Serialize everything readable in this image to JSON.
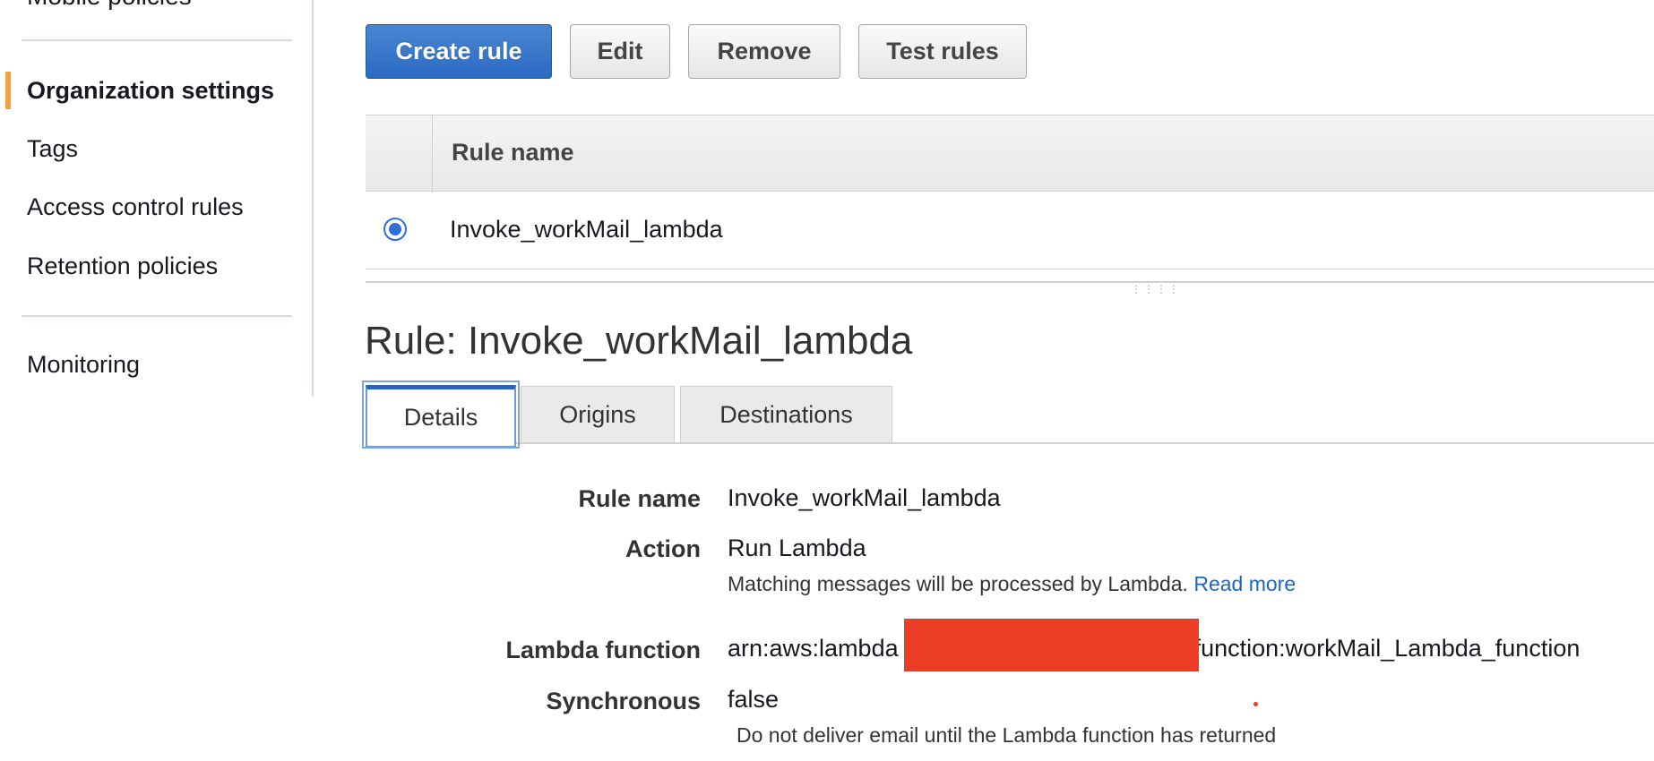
{
  "sidebar": {
    "cut_off_item": "Mobile policies",
    "items": [
      {
        "label": "Organization settings",
        "active": true
      },
      {
        "label": "Tags",
        "active": false
      },
      {
        "label": "Access control rules",
        "active": false
      },
      {
        "label": "Retention policies",
        "active": false
      },
      {
        "label": "Monitoring",
        "active": false
      }
    ],
    "accent_color": "#f5a13d"
  },
  "toolbar": {
    "create_rule": "Create rule",
    "edit": "Edit",
    "remove": "Remove",
    "test_rules": "Test rules"
  },
  "rules_table": {
    "column_header": "Rule name",
    "rows": [
      {
        "name": "Invoke_workMail_lambda",
        "selected": true
      }
    ]
  },
  "rule_detail": {
    "title": "Rule: Invoke_workMail_lambda",
    "tabs": [
      {
        "label": "Details",
        "active": true
      },
      {
        "label": "Origins",
        "active": false
      },
      {
        "label": "Destinations",
        "active": false
      }
    ],
    "fields": {
      "rule_name_label": "Rule name",
      "rule_name_value": "Invoke_workMail_lambda",
      "action_label": "Action",
      "action_value": "Run Lambda",
      "action_help": "Matching messages will be processed by Lambda.",
      "action_help_link": "Read more",
      "lambda_label": "Lambda function",
      "lambda_value_prefix": "arn:aws:lambda",
      "lambda_value_suffix": "function:workMail_Lambda_function",
      "sync_label": "Synchronous",
      "sync_value": "false",
      "sync_help": "Do not deliver email until the Lambda function has returned"
    }
  },
  "colors": {
    "primary_button": "#2b6ac2",
    "link": "#1f66c1",
    "redaction": "#ec3e26"
  }
}
